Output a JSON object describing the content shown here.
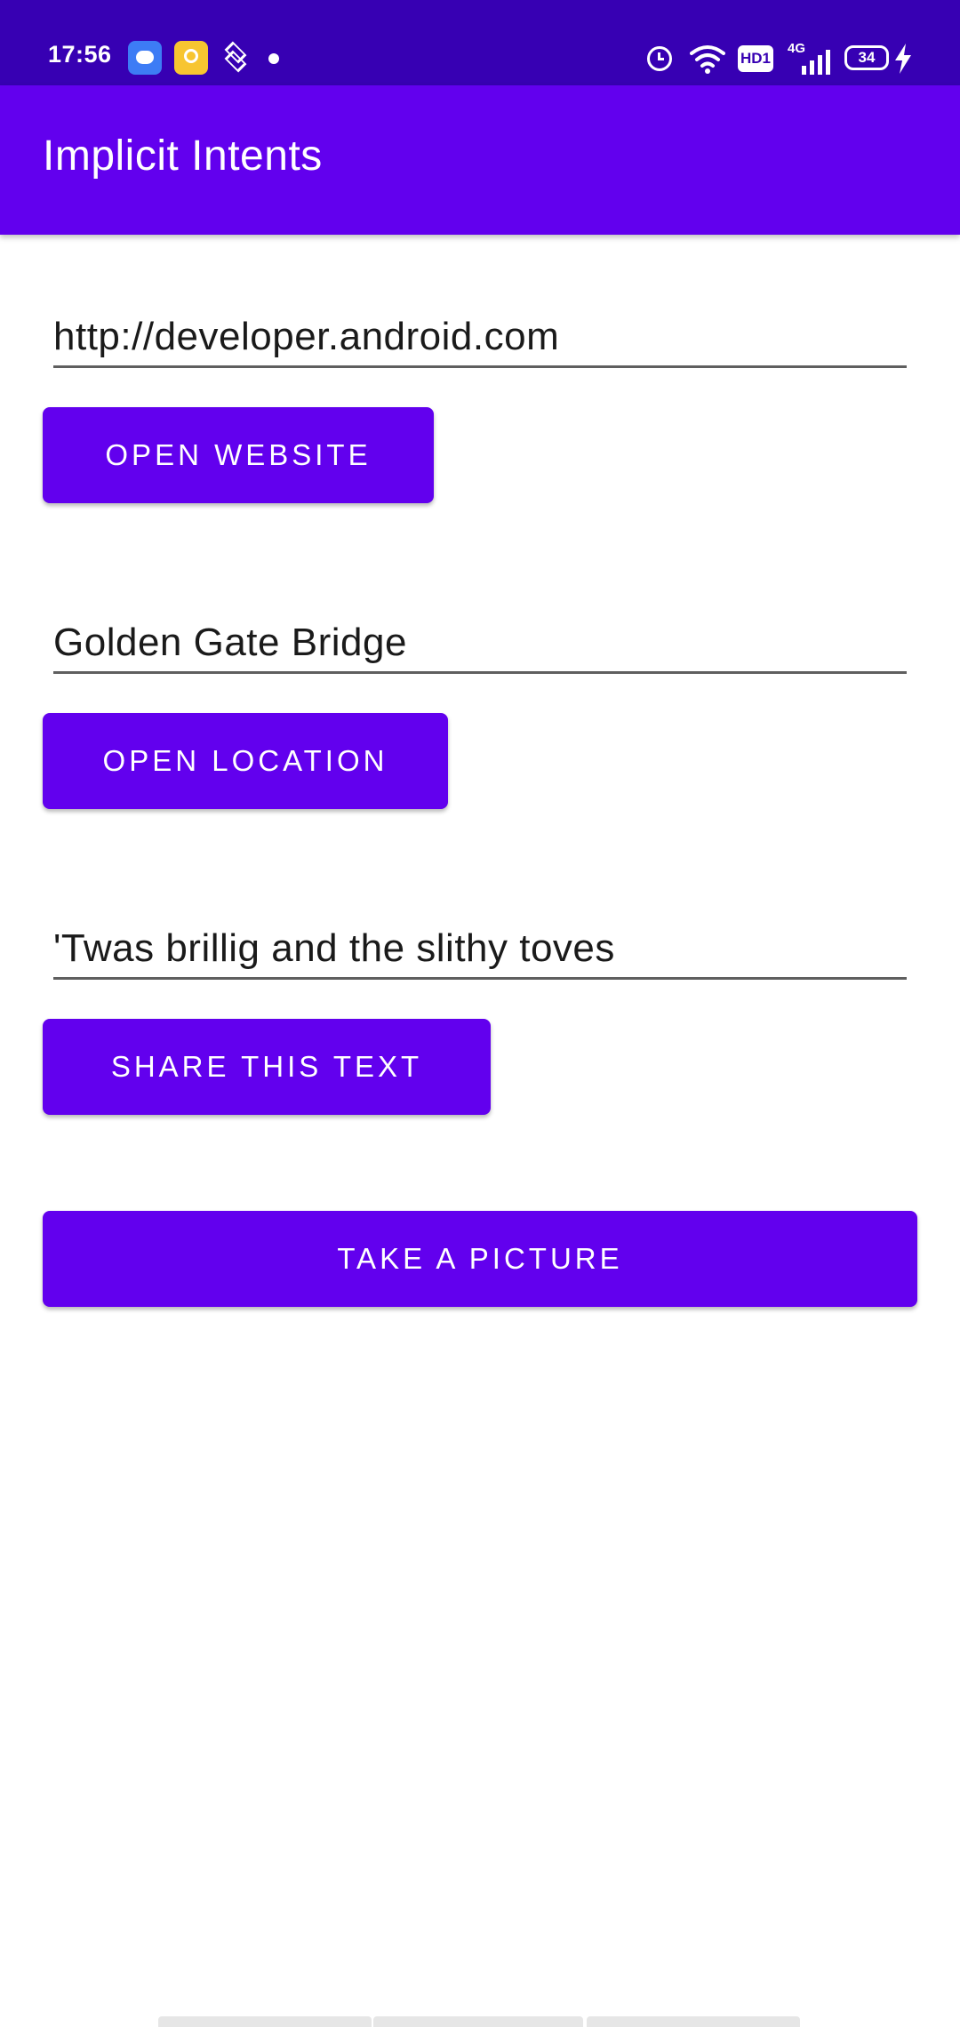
{
  "status_bar": {
    "time": "17:56",
    "network_type": "4G",
    "hd_label": "HD1",
    "battery_level": "34",
    "icons": [
      "cloud-notification-icon",
      "heart-notification-icon",
      "layers-notification-icon",
      "alarm-icon",
      "wifi-icon",
      "hd-voice-icon",
      "signal-icon",
      "battery-icon",
      "charging-icon"
    ]
  },
  "app_bar": {
    "title": "Implicit Intents"
  },
  "website": {
    "field_value": "http://developer.android.com",
    "button_label": "Open Website"
  },
  "location": {
    "field_value": "Golden Gate Bridge",
    "button_label": "Open Location"
  },
  "share": {
    "field_value": "'Twas brillig and the slithy toves",
    "button_label": "Share This Text"
  },
  "camera": {
    "button_label": "Take a Picture"
  },
  "colors": {
    "status_bar": "#3700B3",
    "primary": "#6200EE",
    "button_text": "#FFFFFF",
    "field_underline": "#5F5F5F"
  }
}
